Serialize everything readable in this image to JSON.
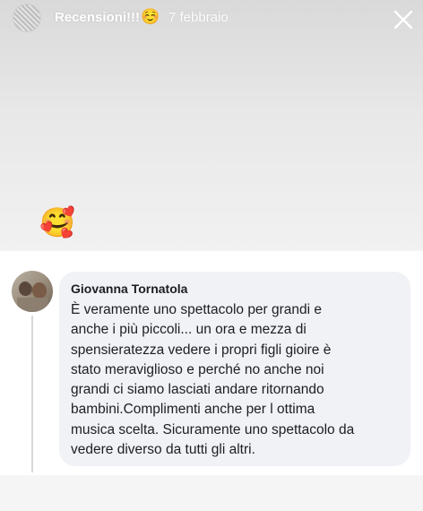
{
  "story": {
    "title": "Recensioni!!!",
    "title_emoji": "☺️",
    "date": "7 febbraio",
    "sticker_emoji": "🥰"
  },
  "comment": {
    "author": "Giovanna Tornatola",
    "text": "È veramente uno spettacolo per grandi e\nanche i più piccoli... un  ora e mezza di\nspensieratezza vedere i propri figli gioire è\nstato meraviglioso e perché no anche noi\ngrandi ci siamo lasciati andare ritornando\nbambini.Complimenti anche per l ottima\nmusica  scelta. Sicuramente uno spettacolo da\nvedere  diverso da tutti gli altri."
  },
  "icons": {
    "close": "close-icon",
    "avatar": "profile-avatar"
  }
}
